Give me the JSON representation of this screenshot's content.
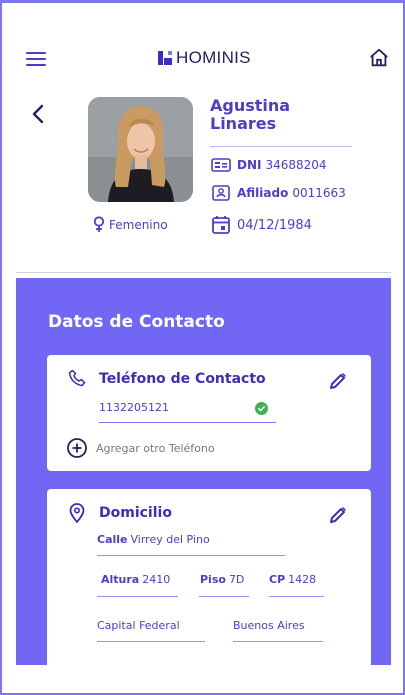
{
  "header": {
    "brand": "HOMINIS",
    "menu_icon": "hamburger-menu-icon",
    "home_icon": "home-icon"
  },
  "profile": {
    "first_name": "Agustina",
    "last_name": "Linares",
    "dni_label": "DNI",
    "dni_value": "34688204",
    "afiliado_label": "Afiliado",
    "afiliado_value": "0011663",
    "birth_date": "04/12/1984",
    "gender": "Femenino"
  },
  "contact": {
    "title": "Datos de Contacto",
    "phone": {
      "title": "Teléfono de Contacto",
      "value": "1132205121",
      "add_label": "Agregar otro Teléfono"
    },
    "address": {
      "title": "Domicilio",
      "calle_label": "Calle",
      "calle_value": "Virrey del Pino",
      "altura_label": "Altura",
      "altura_value": "2410",
      "piso_label": "Piso",
      "piso_value": "7D",
      "cp_label": "CP",
      "cp_value": "1428",
      "ciudad": "Capital Federal",
      "provincia": "Buenos Aires"
    }
  },
  "colors": {
    "accent": "#4a3fc8",
    "panel": "#7267f5",
    "success": "#3bb54a"
  }
}
